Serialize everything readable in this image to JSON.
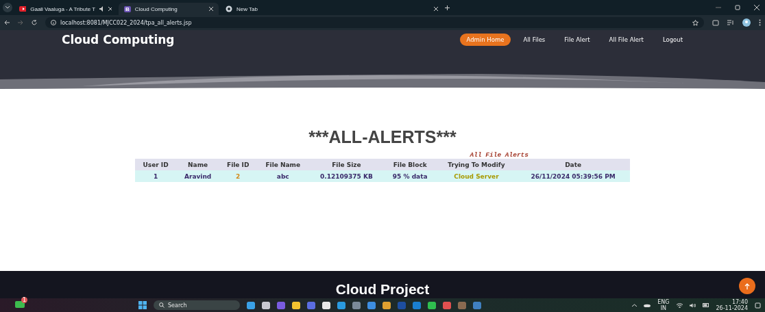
{
  "browser": {
    "tabs": [
      {
        "title": "Gaali Vaaluga - A Tribute T",
        "selected": false,
        "kind": "media"
      },
      {
        "title": "Cloud Computing",
        "selected": true,
        "kind": "site",
        "favicon": "B"
      },
      {
        "title": "New Tab",
        "selected": false,
        "kind": "newtab"
      }
    ],
    "address": "localhost:8081/MJCC022_2024/tpa_all_alerts.jsp"
  },
  "site": {
    "brand": "Cloud Computing",
    "nav": [
      {
        "label": "Admin Home",
        "selected": true
      },
      {
        "label": "All Files",
        "selected": false
      },
      {
        "label": "File Alert",
        "selected": false
      },
      {
        "label": "All File Alert",
        "selected": false
      },
      {
        "label": "Logout",
        "selected": false
      }
    ],
    "heading": "***ALL-ALERTS***",
    "table": {
      "caption": "All File Alerts",
      "columns": [
        "User ID",
        "Name",
        "File ID",
        "File Name",
        "File Size",
        "File Block",
        "Trying To Modify",
        "Date"
      ],
      "rows": [
        [
          "1",
          "Aravind",
          "2",
          "abc",
          "0.12109375  KB",
          "95 % data",
          "Cloud Server",
          "26/11/2024 05:39:56 PM"
        ]
      ]
    },
    "footer": "Cloud Project"
  },
  "taskbar": {
    "badge": "1",
    "search": "Search",
    "lang": "ENG",
    "region": "IN",
    "time": "17:40",
    "date": "26-11-2024"
  }
}
